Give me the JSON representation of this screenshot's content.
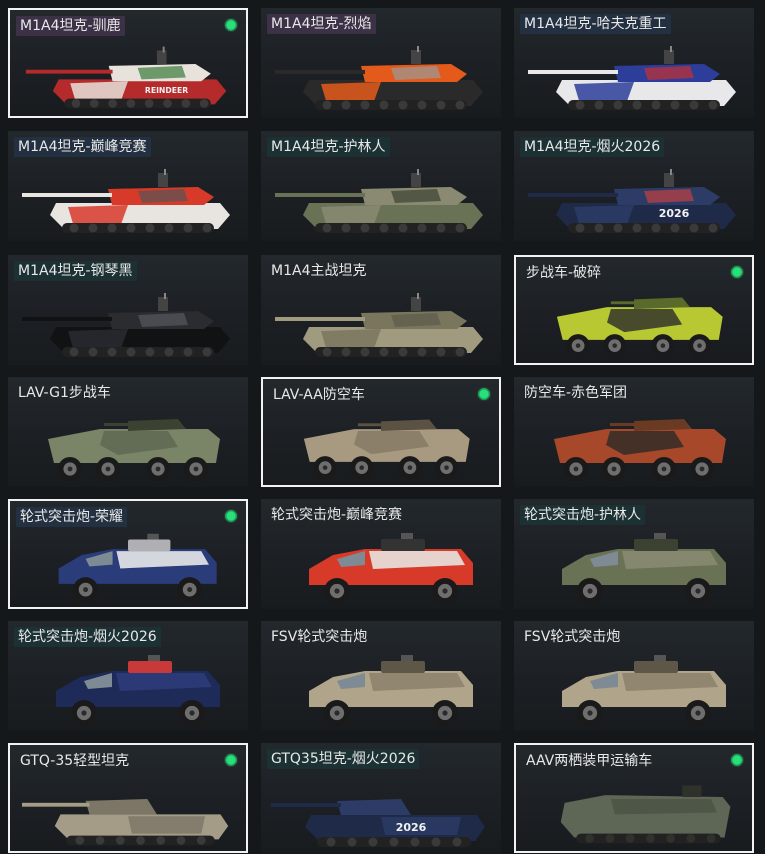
{
  "colors": {
    "selected_border": "#f2f2f2",
    "owned_indicator": "#27e07a",
    "card_background": "#1e2226"
  },
  "vehicles": [
    {
      "name": "M1A4坦克-驯鹿",
      "type": "tank",
      "selected": true,
      "owned": true,
      "label_style": "purple",
      "colors": [
        "#b52a2a",
        "#e8e2dc",
        "#3a7a3a"
      ],
      "decal": "REINDEER"
    },
    {
      "name": "M1A4坦克-烈焰",
      "type": "tank",
      "selected": false,
      "owned": false,
      "label_style": "purple",
      "colors": [
        "#2a2a2a",
        "#e45a1a",
        "#9a9a9a"
      ],
      "decal": ""
    },
    {
      "name": "M1A4坦克-哈夫克重工",
      "type": "tank",
      "selected": false,
      "owned": false,
      "label_style": "blue",
      "colors": [
        "#e8e8ea",
        "#2c3e9a",
        "#c83030"
      ],
      "decal": ""
    },
    {
      "name": "M1A4坦克-巅峰竞赛",
      "type": "tank",
      "selected": false,
      "owned": false,
      "label_style": "blue",
      "colors": [
        "#e8e4e0",
        "#d83a2a",
        "#555555"
      ],
      "decal": ""
    },
    {
      "name": "M1A4坦克-护林人",
      "type": "tank",
      "selected": false,
      "owned": false,
      "label_style": "teal",
      "colors": [
        "#6a7256",
        "#8a8a72",
        "#3c4232"
      ],
      "decal": ""
    },
    {
      "name": "M1A4坦克-烟火2026",
      "type": "tank",
      "selected": false,
      "owned": false,
      "label_style": "teal",
      "colors": [
        "#1e2a48",
        "#2c3c66",
        "#c04040"
      ],
      "decal": "2026"
    },
    {
      "name": "M1A4坦克-钢琴黑",
      "type": "tank",
      "selected": false,
      "owned": false,
      "label_style": "teal",
      "colors": [
        "#111214",
        "#2a2c30",
        "#55585e"
      ],
      "decal": ""
    },
    {
      "name": "M1A4主战坦克",
      "type": "tank",
      "selected": false,
      "owned": false,
      "label_style": "none",
      "colors": [
        "#a09a7e",
        "#7a765e",
        "#5c5a48"
      ],
      "decal": ""
    },
    {
      "name": "步战车-破碎",
      "type": "apc",
      "selected": true,
      "owned": true,
      "label_style": "none",
      "colors": [
        "#b8c832",
        "#2a2c2a",
        "#5a6a2a"
      ],
      "decal": ""
    },
    {
      "name": "LAV-G1步战车",
      "type": "apc",
      "selected": false,
      "owned": false,
      "label_style": "none",
      "colors": [
        "#7a8466",
        "#5e6650",
        "#3c4232"
      ],
      "decal": ""
    },
    {
      "name": "LAV-AA防空车",
      "type": "apc",
      "selected": true,
      "owned": true,
      "label_style": "none",
      "colors": [
        "#a89a80",
        "#857864",
        "#5c5244"
      ],
      "decal": ""
    },
    {
      "name": "防空车-赤色军团",
      "type": "apc",
      "selected": false,
      "owned": false,
      "label_style": "none",
      "colors": [
        "#a8482a",
        "#2c2a28",
        "#6a3a22"
      ],
      "decal": ""
    },
    {
      "name": "轮式突击炮-荣耀",
      "type": "truck",
      "selected": true,
      "owned": true,
      "label_style": "blue",
      "colors": [
        "#2a3c7a",
        "#e8e8ea",
        "#b0b0b4"
      ],
      "decal": ""
    },
    {
      "name": "轮式突击炮-巅峰竞赛",
      "type": "truck",
      "selected": false,
      "owned": false,
      "label_style": "none",
      "colors": [
        "#d83a2a",
        "#e8e4e0",
        "#333333"
      ],
      "decal": ""
    },
    {
      "name": "轮式突击炮-护林人",
      "type": "truck",
      "selected": false,
      "owned": false,
      "label_style": "teal",
      "colors": [
        "#6a7256",
        "#8a8a72",
        "#3c4232"
      ],
      "decal": ""
    },
    {
      "name": "轮式突击炮-烟火2026",
      "type": "truck",
      "selected": false,
      "owned": false,
      "label_style": "teal",
      "colors": [
        "#1e2a58",
        "#2c3c7a",
        "#c83a3a"
      ],
      "decal": ""
    },
    {
      "name": "FSV轮式突击炮",
      "type": "truck",
      "selected": false,
      "owned": false,
      "label_style": "none",
      "colors": [
        "#b0a48a",
        "#8e836c",
        "#5e5646"
      ],
      "decal": ""
    },
    {
      "name": "FSV轮式突击炮",
      "type": "truck",
      "selected": false,
      "owned": false,
      "label_style": "none",
      "colors": [
        "#b0a48a",
        "#8e836c",
        "#5e5646"
      ],
      "decal": ""
    },
    {
      "name": "GTQ-35轻型坦克",
      "type": "light",
      "selected": true,
      "owned": true,
      "label_style": "none",
      "colors": [
        "#a49c86",
        "#7c7666",
        "#4c4a40"
      ],
      "decal": ""
    },
    {
      "name": "GTQ35坦克-烟火2026",
      "type": "light",
      "selected": false,
      "owned": false,
      "label_style": "teal",
      "colors": [
        "#1e2a48",
        "#2c3c66",
        "#c04040"
      ],
      "decal": "2026"
    },
    {
      "name": "AAV两栖装甲运输车",
      "type": "amphib",
      "selected": true,
      "owned": true,
      "label_style": "none",
      "colors": [
        "#5e6656",
        "#4a5244",
        "#2e322a"
      ],
      "decal": ""
    }
  ]
}
